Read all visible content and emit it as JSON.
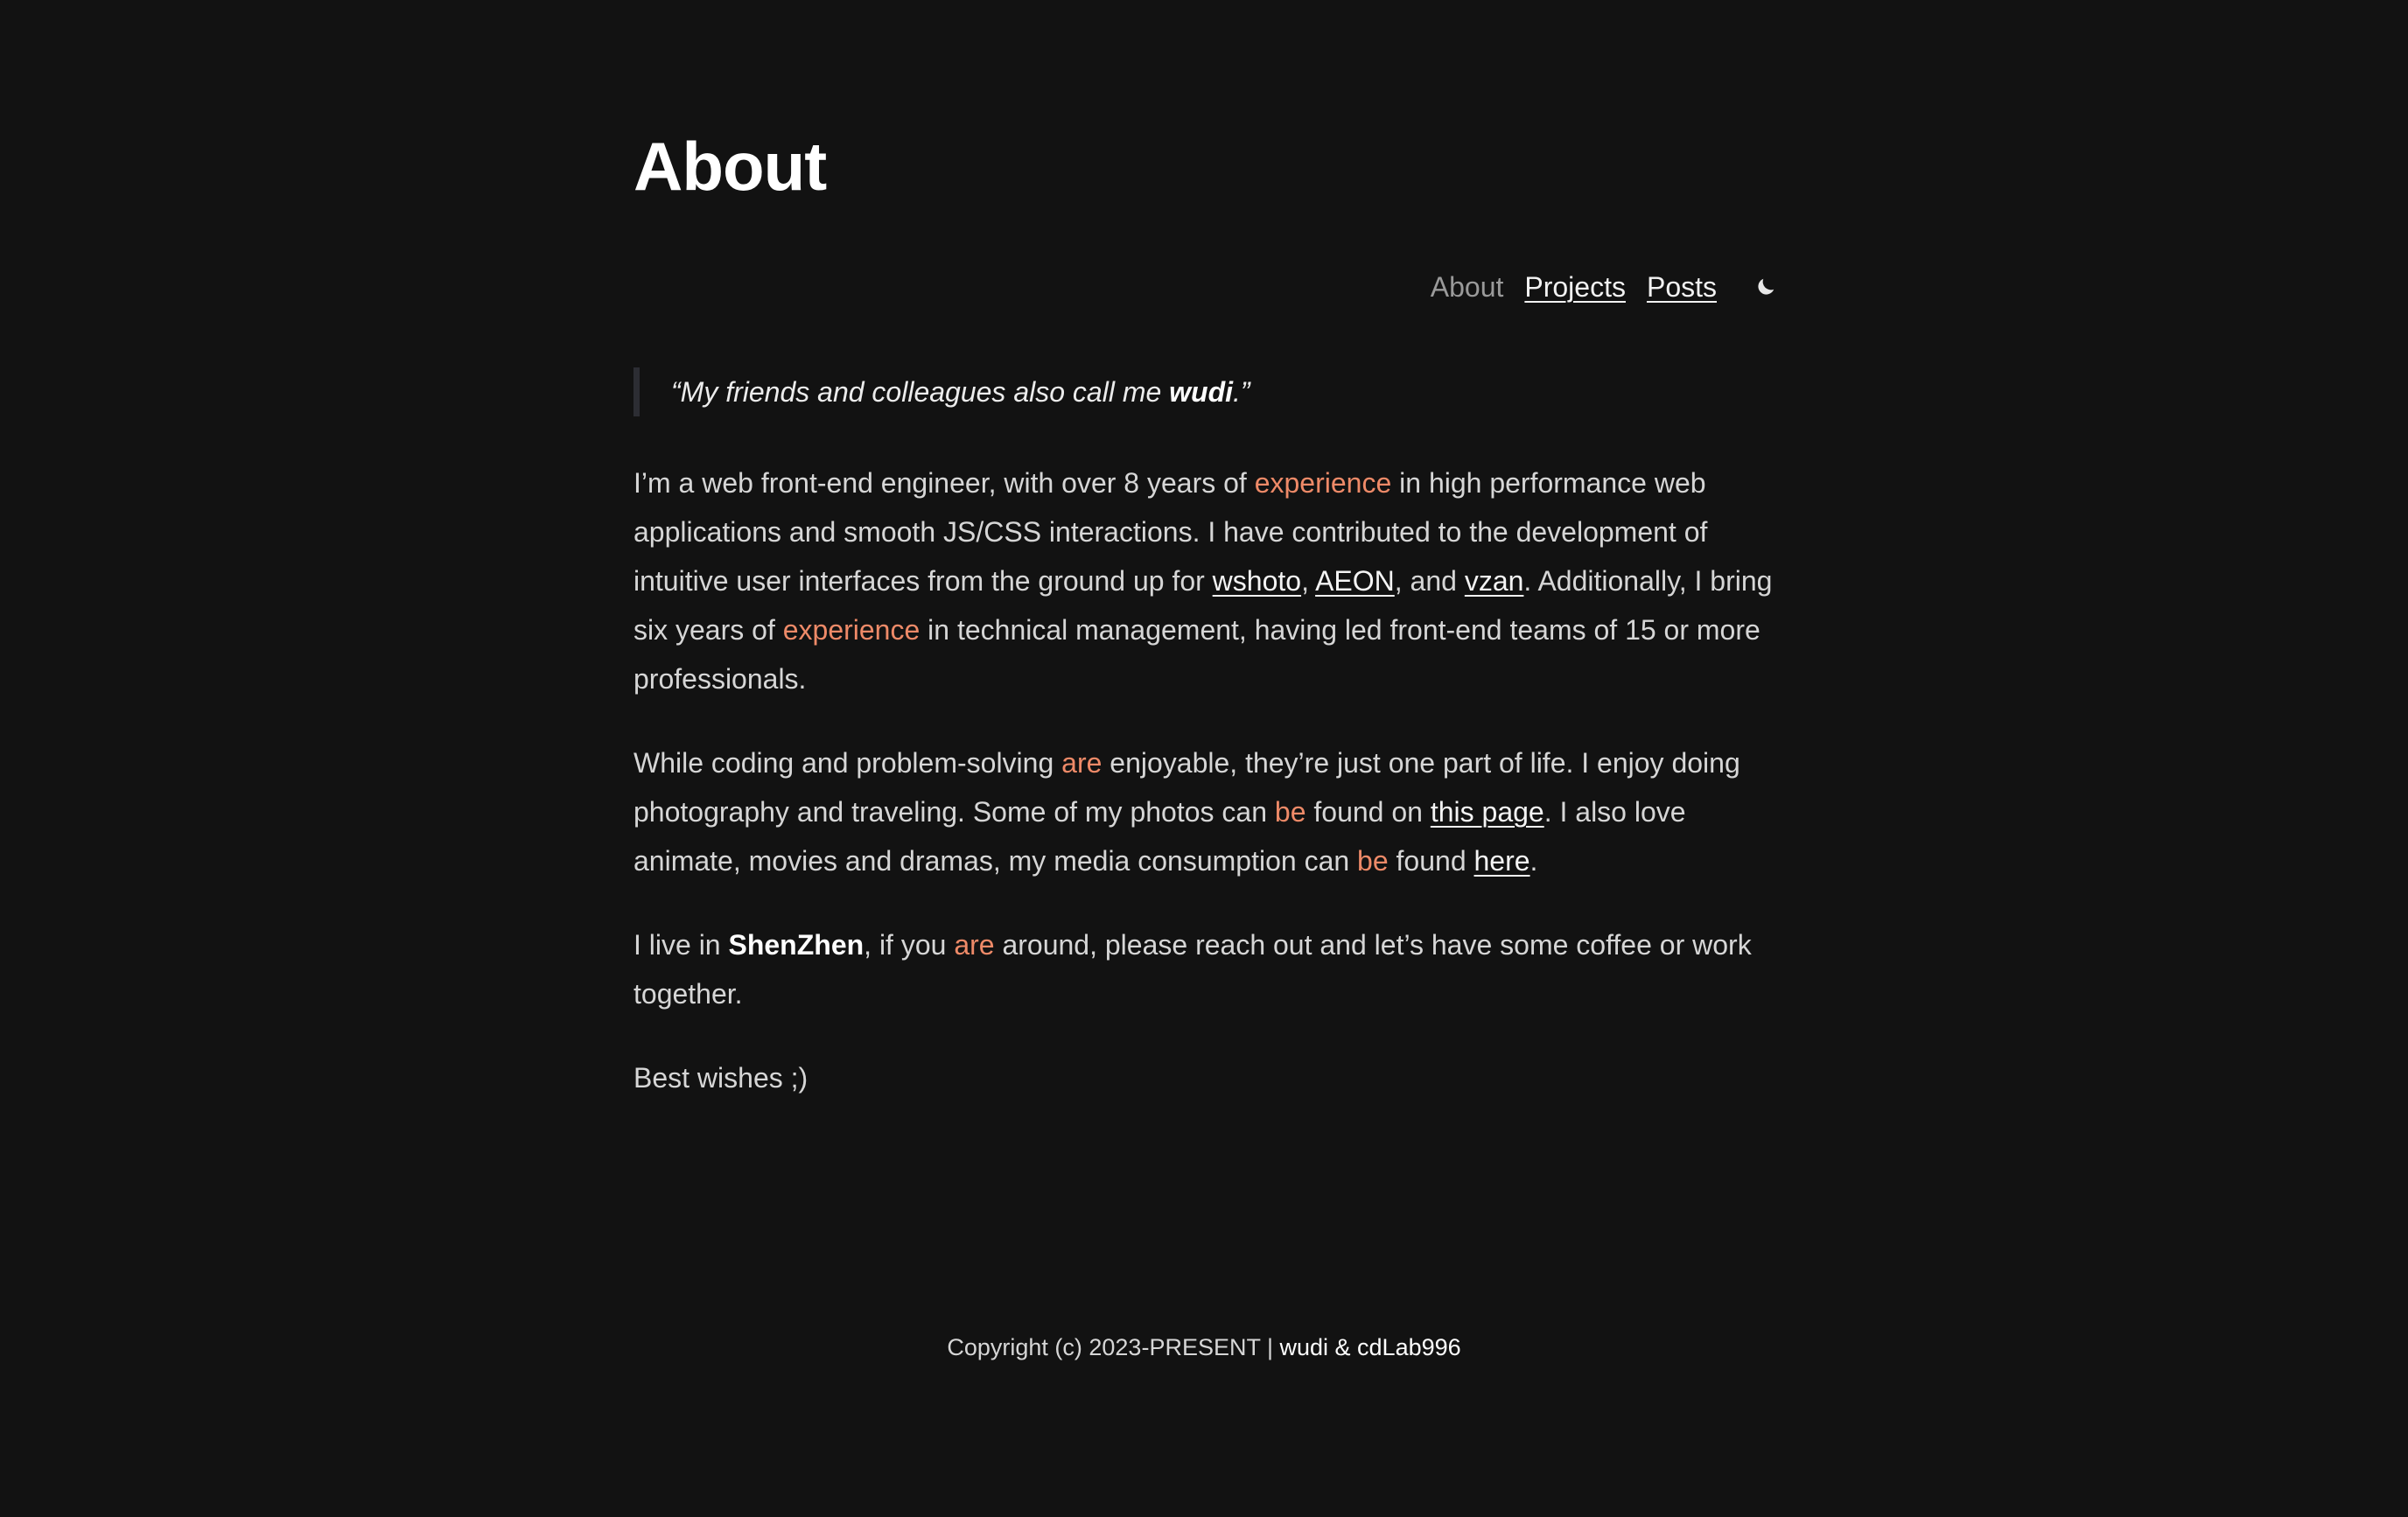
{
  "page": {
    "title": "About"
  },
  "nav": {
    "about": "About",
    "projects": "Projects",
    "posts": "Posts",
    "theme_icon": "moon-icon"
  },
  "quote": {
    "before": "“My friends and colleagues also call me ",
    "name": "wudi",
    "after": ".”"
  },
  "para1": {
    "t1": "I’m a web front-end engineer, with over 8 years of ",
    "h1": "experience",
    "t2": " in high performance web applications and smooth JS/CSS interactions. I have contributed to the development of intuitive user interfaces from the ground up for ",
    "link_wshoto": "wshoto",
    "sep1": ", ",
    "link_aeon": "AEON",
    "sep2": ", and ",
    "link_vzan": "vzan",
    "t3": ". Additionally, I bring six years of ",
    "h2": "experience",
    "t4": " in technical management, having led front-end teams of 15 or more professionals."
  },
  "para2": {
    "t1": "While coding and problem-solving ",
    "h1": "are",
    "t2": " enjoyable, they’re just one part of life. I enjoy doing photography and traveling. Some of my photos can ",
    "h2": "be",
    "t3": " found on ",
    "link_page": "this page",
    "t4": ". I also love animate, movies and dramas, my media consumption can ",
    "h3": "be",
    "t5": " found ",
    "link_here": "here",
    "t6": "."
  },
  "para3": {
    "t1": "I live in ",
    "city": "ShenZhen",
    "t2": ", if you ",
    "h1": "are",
    "t3": " around, please reach out and let’s have some coffee or work together."
  },
  "para4": {
    "text": "Best wishes ;)"
  },
  "footer": {
    "copyright": "Copyright (c) 2023-PRESENT | ",
    "authors": "wudi & cdLab996"
  },
  "colors": {
    "background": "#121212",
    "highlight": "#ee8a68"
  }
}
